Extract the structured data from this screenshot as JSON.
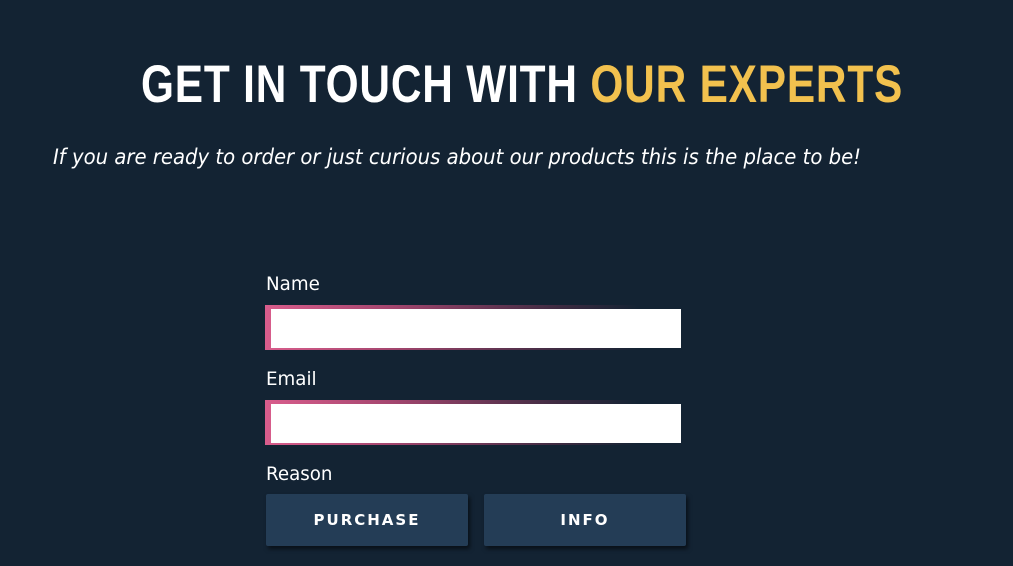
{
  "header": {
    "title_main": "GET IN TOUCH WITH ",
    "title_accent": "OUR EXPERTS",
    "subtitle": "If you are ready to order or just curious about our products this is the place to be!"
  },
  "form": {
    "name_label": "Name",
    "name_value": "",
    "email_label": "Email",
    "email_value": "",
    "reason_label": "Reason",
    "reason_options": [
      "PURCHASE",
      "INFO"
    ]
  },
  "colors": {
    "background": "#132333",
    "accent": "#f2c14e",
    "field_border": "#d95d8c",
    "button": "#243d56"
  }
}
